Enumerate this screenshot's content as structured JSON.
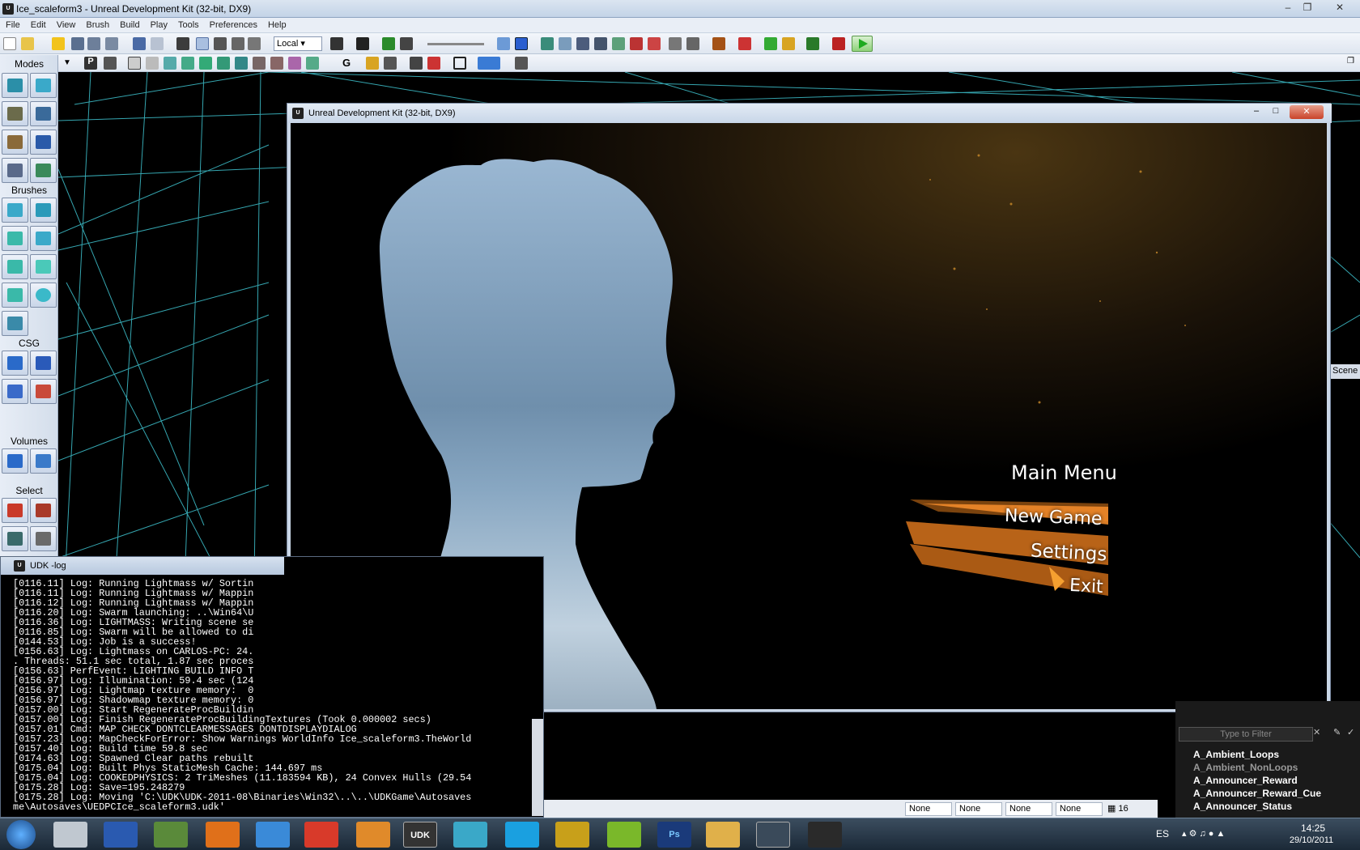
{
  "window": {
    "title": "Ice_scaleform3 - Unreal Development Kit (32-bit, DX9)",
    "icon": "udk-icon"
  },
  "menu": [
    "File",
    "Edit",
    "View",
    "Brush",
    "Build",
    "Play",
    "Tools",
    "Preferences",
    "Help"
  ],
  "toolbar": {
    "coord_system": "Local"
  },
  "modes_panel": {
    "header": "Modes",
    "sections": [
      "Brushes",
      "CSG",
      "Volumes",
      "Select"
    ]
  },
  "game_window": {
    "title": "Unreal Development Kit (32-bit, DX9)",
    "main_menu": {
      "title": "Main Menu",
      "items": [
        "New Game",
        "Settings",
        "Exit"
      ],
      "hovered": "Settings",
      "accent": "#e07a1a"
    }
  },
  "log_window": {
    "title": "UDK -log",
    "lines": [
      "[0116.11] Log: Running Lightmass w/ Sortin",
      "[0116.11] Log: Running Lightmass w/ Mappin",
      "[0116.12] Log: Running Lightmass w/ Mappin",
      "[0116.20] Log: Swarm launching: ..\\Win64\\U",
      "[0116.36] Log: LIGHTMASS: Writing scene se",
      "[0116.85] Log: Swarm will be allowed to di",
      "[0144.53] Log: Job is a success!",
      "[0156.63] Log: Lightmass on CARLOS-PC: 24.",
      ". Threads: 51.1 sec total, 1.87 sec proces",
      "[0156.63] PerfEvent: LIGHTING BUILD INFO T",
      "[0156.97] Log: Illumination: 59.4 sec (124",
      "[0156.97] Log: Lightmap texture memory:  0",
      "[0156.97] Log: Shadowmap texture memory: 0",
      "[0157.00] Log: Start RegenerateProcBuildin",
      "[0157.00] Log: Finish RegenerateProcBuildingTextures (Took 0.000002 secs)",
      "[0157.01] Cmd: MAP CHECK DONTCLEARMESSAGES DONTDISPLAYDIALOG",
      "[0157.23] Log: MapCheckForError: Show Warnings WorldInfo Ice_scaleform3.TheWorld",
      "[0157.40] Log: Build time 59.8 sec",
      "[0174.63] Log: Spawned Clear paths rebuilt",
      "[0175.04] Log: Built Phys StaticMesh Cache: 144.697 ms",
      "[0175.04] Log: COOKEDPHYSICS: 2 TriMeshes (11.183594 KB), 24 Convex Hulls (29.54",
      "[0175.28] Log: Save=195.248279",
      "[0175.28] Log: Moving 'C:\\UDK\\UDK-2011-08\\Binaries\\Win32\\..\\..\\UDKGame\\Autosaves",
      "me\\Autosaves\\UEDPCIce_scaleform3.udk'"
    ]
  },
  "content_browser": {
    "tab": "Scene",
    "filter_placeholder": "Type to Filter",
    "packages": [
      "A_Ambient_Loops",
      "A_Ambient_NonLoops",
      "A_Announcer_Reward",
      "A_Announcer_Reward_Cue",
      "A_Announcer_Status"
    ]
  },
  "status_bar": {
    "fields": [
      "None",
      "None",
      "None",
      "None"
    ],
    "grid": "16"
  },
  "taskbar": {
    "apps": [
      "windows-start",
      "microphone",
      "word",
      "minecraft",
      "firefox",
      "dropbox",
      "chrome",
      "media-player",
      "udk",
      "messenger",
      "skype",
      "quicktime",
      "spotify",
      "photoshop",
      "explorer",
      "steam",
      "scaleform"
    ],
    "language": "ES",
    "time": "14:25",
    "date": "29/10/2011"
  }
}
